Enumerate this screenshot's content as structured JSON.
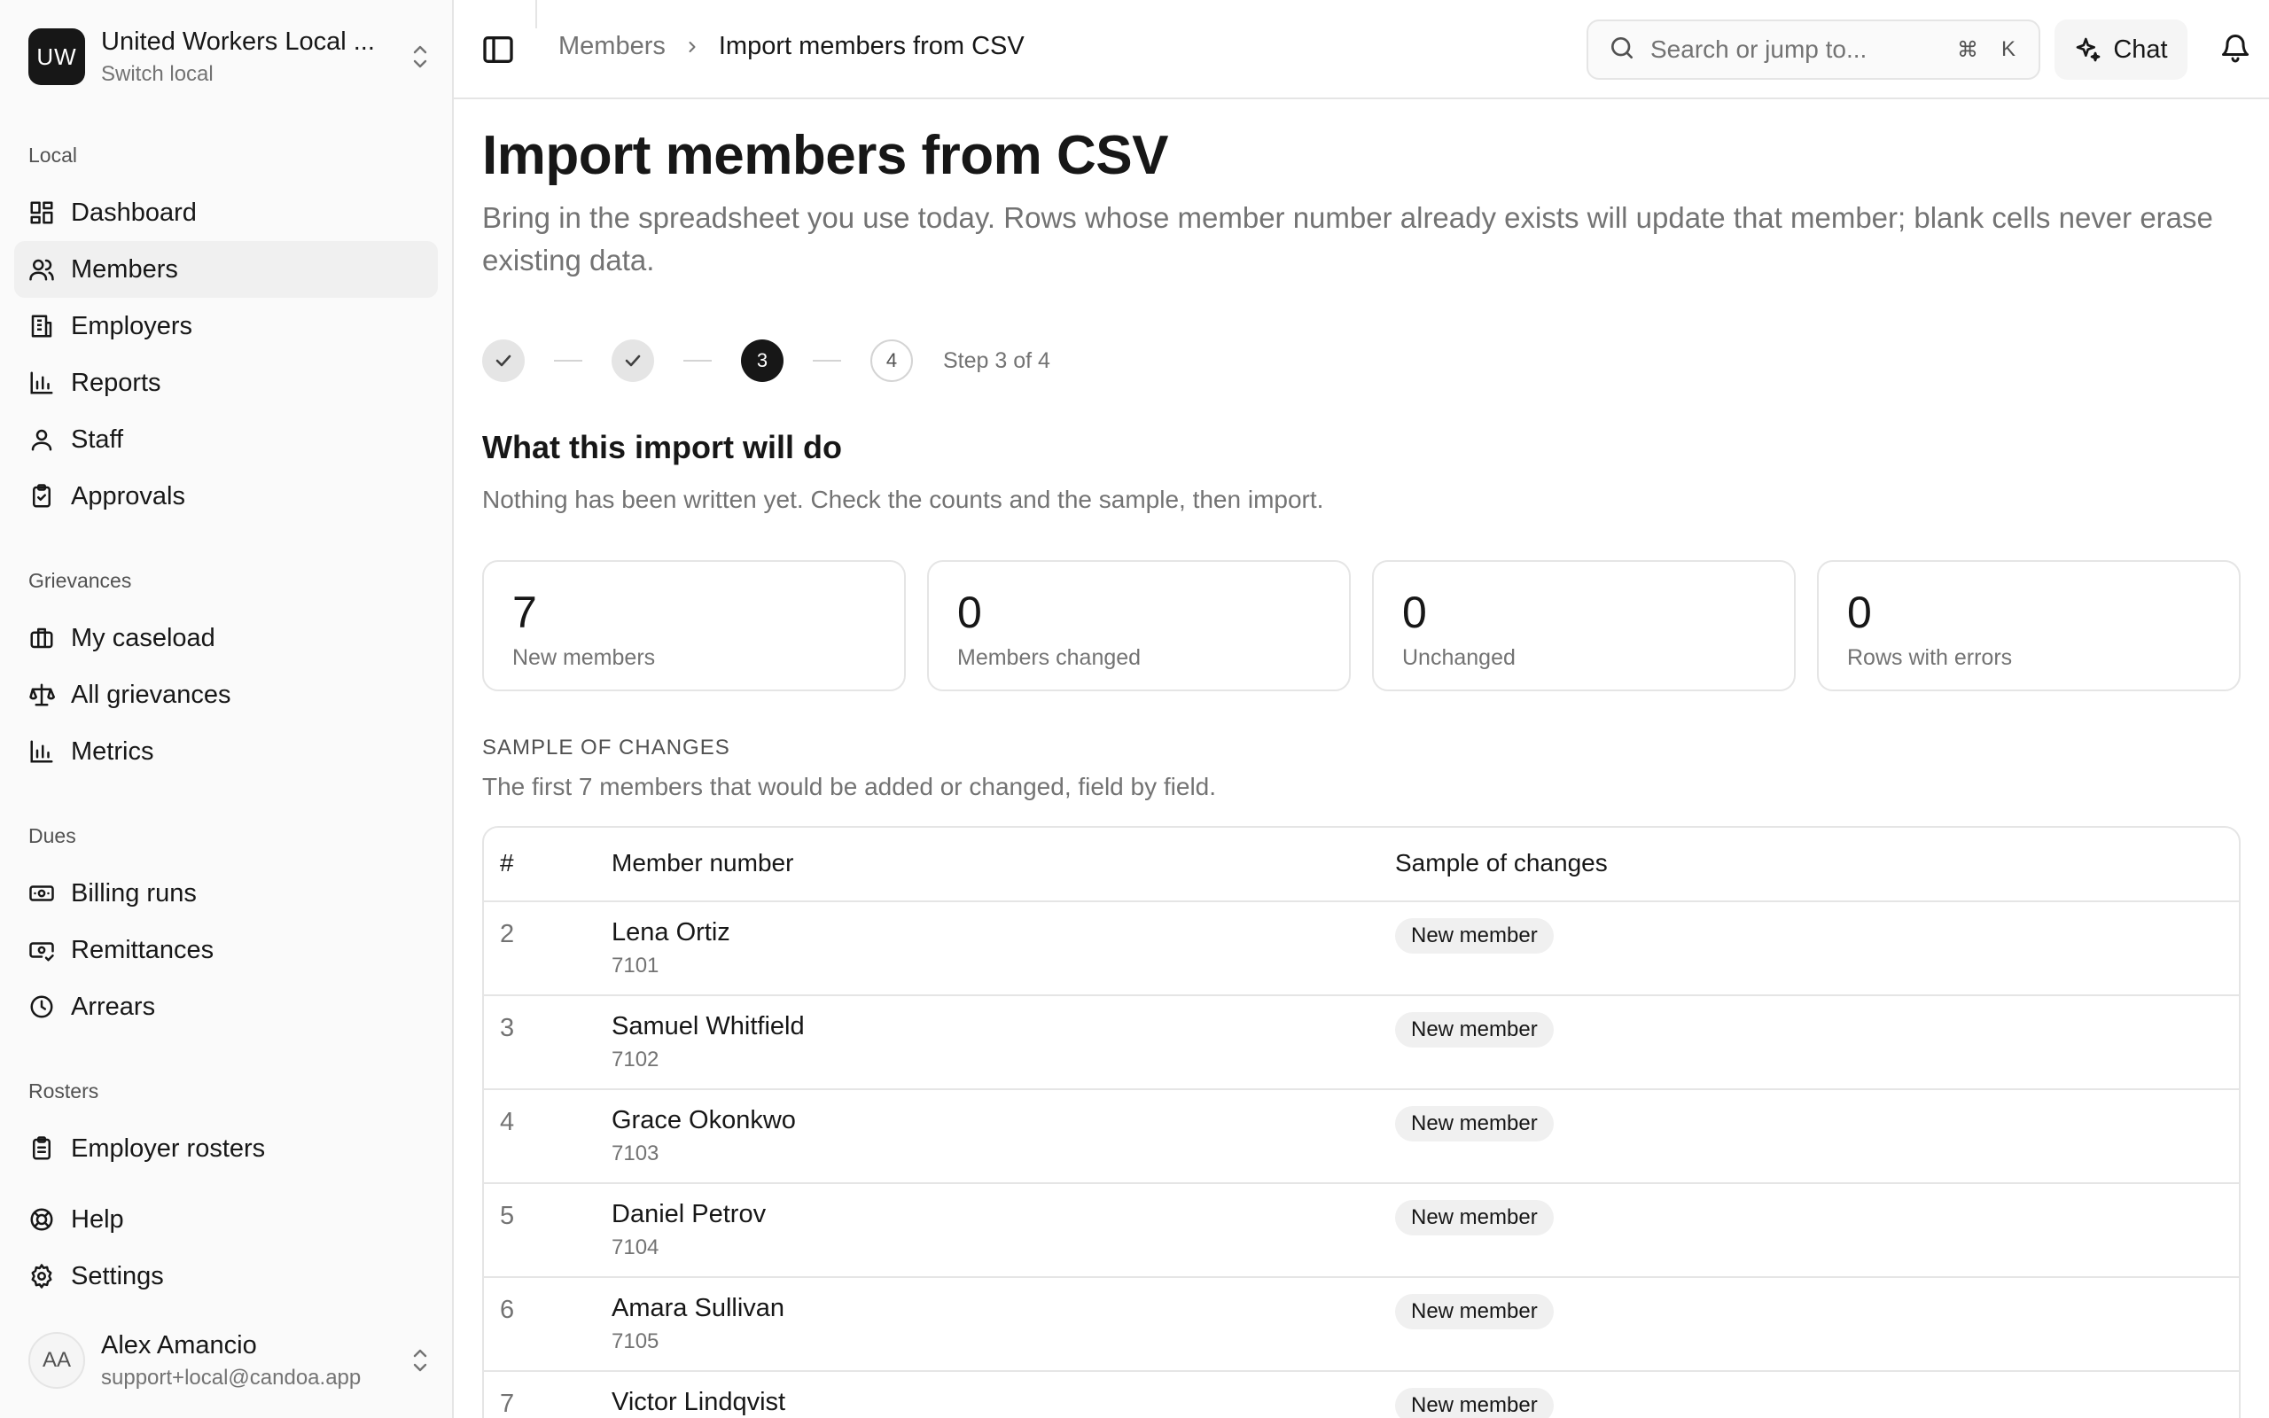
{
  "org": {
    "initials": "UW",
    "name": "United Workers Local ...",
    "subtitle": "Switch local"
  },
  "nav": {
    "local": {
      "heading": "Local",
      "items": [
        {
          "label": "Dashboard",
          "icon": "dashboard-icon"
        },
        {
          "label": "Members",
          "icon": "users-icon",
          "active": true
        },
        {
          "label": "Employers",
          "icon": "building-icon"
        },
        {
          "label": "Reports",
          "icon": "bar-chart-icon"
        },
        {
          "label": "Staff",
          "icon": "user-icon"
        },
        {
          "label": "Approvals",
          "icon": "clipboard-check-icon"
        }
      ]
    },
    "grievances": {
      "heading": "Grievances",
      "items": [
        {
          "label": "My caseload",
          "icon": "briefcase-icon"
        },
        {
          "label": "All grievances",
          "icon": "scale-icon"
        },
        {
          "label": "Metrics",
          "icon": "bar-chart-icon"
        }
      ]
    },
    "dues": {
      "heading": "Dues",
      "items": [
        {
          "label": "Billing runs",
          "icon": "banknote-icon"
        },
        {
          "label": "Remittances",
          "icon": "remittance-icon"
        },
        {
          "label": "Arrears",
          "icon": "clock-icon"
        }
      ]
    },
    "rosters": {
      "heading": "Rosters",
      "items": [
        {
          "label": "Employer rosters",
          "icon": "clipboard-list-icon"
        }
      ]
    },
    "footer_items": [
      {
        "label": "Help",
        "icon": "lifebuoy-icon"
      },
      {
        "label": "Settings",
        "icon": "gear-icon"
      }
    ]
  },
  "user": {
    "initials": "AA",
    "name": "Alex Amancio",
    "email": "support+local@candoa.app"
  },
  "topbar": {
    "breadcrumb": {
      "parent": "Members",
      "current": "Import members from CSV"
    },
    "search": {
      "placeholder": "Search or jump to...",
      "shortcut_cmd": "⌘",
      "shortcut_key": "K"
    },
    "chat_label": "Chat"
  },
  "page": {
    "title": "Import members from CSV",
    "description": "Bring in the spreadsheet you use today. Rows whose member number already exists will update that member; blank cells never erase existing data."
  },
  "stepper": {
    "steps": [
      {
        "state": "done",
        "label": ""
      },
      {
        "state": "done",
        "label": ""
      },
      {
        "state": "current",
        "label": "3"
      },
      {
        "state": "todo",
        "label": "4"
      }
    ],
    "status": "Step 3 of 4"
  },
  "summary": {
    "title": "What this import will do",
    "subtitle": "Nothing has been written yet. Check the counts and the sample, then import.",
    "stats": [
      {
        "value": "7",
        "label": "New members"
      },
      {
        "value": "0",
        "label": "Members changed"
      },
      {
        "value": "0",
        "label": "Unchanged"
      },
      {
        "value": "0",
        "label": "Rows with errors"
      }
    ]
  },
  "sample": {
    "heading": "SAMPLE OF CHANGES",
    "subtitle": "The first 7 members that would be added or changed, field by field.",
    "columns": [
      "#",
      "Member number",
      "Sample of changes"
    ],
    "rows": [
      {
        "num": "2",
        "name": "Lena Ortiz",
        "member_id": "7101",
        "change": "New member"
      },
      {
        "num": "3",
        "name": "Samuel Whitfield",
        "member_id": "7102",
        "change": "New member"
      },
      {
        "num": "4",
        "name": "Grace Okonkwo",
        "member_id": "7103",
        "change": "New member"
      },
      {
        "num": "5",
        "name": "Daniel Petrov",
        "member_id": "7104",
        "change": "New member"
      },
      {
        "num": "6",
        "name": "Amara Sullivan",
        "member_id": "7105",
        "change": "New member"
      },
      {
        "num": "7",
        "name": "Victor Lindqvist",
        "member_id": "",
        "change": "New member"
      }
    ]
  }
}
